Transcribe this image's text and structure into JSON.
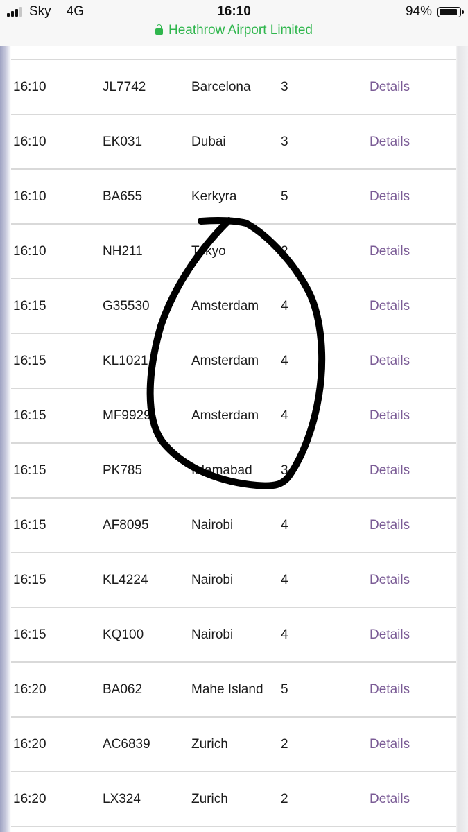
{
  "status_bar": {
    "carrier": "Sky",
    "network": "4G",
    "time": "16:10",
    "battery_percent_label": "94%",
    "battery_level": 0.94,
    "signal_bars": 3
  },
  "browser": {
    "site_label": "Heathrow Airport Limited",
    "secure_color": "#2fb64d"
  },
  "colors": {
    "details_link": "#7b5c96",
    "annotation": "#000000"
  },
  "flights": [
    {
      "time": "16:10",
      "flight": "JL7742",
      "destination": "Barcelona",
      "terminal": "3",
      "action": "Details"
    },
    {
      "time": "16:10",
      "flight": "EK031",
      "destination": "Dubai",
      "terminal": "3",
      "action": "Details"
    },
    {
      "time": "16:10",
      "flight": "BA655",
      "destination": "Kerkyra",
      "terminal": "5",
      "action": "Details"
    },
    {
      "time": "16:10",
      "flight": "NH211",
      "destination": "Tokyo",
      "terminal": "2",
      "action": "Details"
    },
    {
      "time": "16:15",
      "flight": "G35530",
      "destination": "Amsterdam",
      "terminal": "4",
      "action": "Details"
    },
    {
      "time": "16:15",
      "flight": "KL1021",
      "destination": "Amsterdam",
      "terminal": "4",
      "action": "Details"
    },
    {
      "time": "16:15",
      "flight": "MF9929",
      "destination": "Amsterdam",
      "terminal": "4",
      "action": "Details"
    },
    {
      "time": "16:15",
      "flight": "PK785",
      "destination": "Islamabad",
      "terminal": "3",
      "action": "Details"
    },
    {
      "time": "16:15",
      "flight": "AF8095",
      "destination": "Nairobi",
      "terminal": "4",
      "action": "Details"
    },
    {
      "time": "16:15",
      "flight": "KL4224",
      "destination": "Nairobi",
      "terminal": "4",
      "action": "Details"
    },
    {
      "time": "16:15",
      "flight": "KQ100",
      "destination": "Nairobi",
      "terminal": "4",
      "action": "Details"
    },
    {
      "time": "16:20",
      "flight": "BA062",
      "destination": "Mahe Island",
      "terminal": "5",
      "action": "Details"
    },
    {
      "time": "16:20",
      "flight": "AC6839",
      "destination": "Zurich",
      "terminal": "2",
      "action": "Details"
    },
    {
      "time": "16:20",
      "flight": "LX324",
      "destination": "Zurich",
      "terminal": "2",
      "action": "Details"
    }
  ]
}
